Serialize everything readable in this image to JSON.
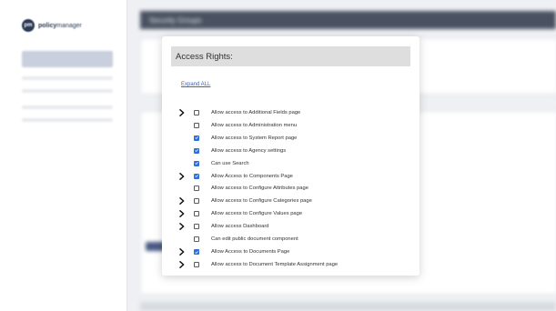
{
  "sidebar": {
    "logo_badge": "pm",
    "logo_text_bold": "policy",
    "logo_text_rest": "manager"
  },
  "main": {
    "header_title": "Security Groups"
  },
  "modal": {
    "title": "Access Rights:",
    "expand_all": "Expand ALL",
    "rights": [
      {
        "label": "Allow access to Additional Fields page",
        "checked": false,
        "expandable": true
      },
      {
        "label": "Allow access to Administration menu",
        "checked": false,
        "expandable": false
      },
      {
        "label": "Allow access to System Report page",
        "checked": true,
        "expandable": false
      },
      {
        "label": "Allow access to Agency settings",
        "checked": true,
        "expandable": false
      },
      {
        "label": "Can use Search",
        "checked": true,
        "expandable": false
      },
      {
        "label": "Allow Access to Components Page",
        "checked": true,
        "expandable": true
      },
      {
        "label": "Allow access to Configure Attributes page",
        "checked": false,
        "expandable": false
      },
      {
        "label": "Allow access to Configure Categories page",
        "checked": false,
        "expandable": true
      },
      {
        "label": "Allow access to Configure Values page",
        "checked": false,
        "expandable": true
      },
      {
        "label": "Allow access Dashboard",
        "checked": false,
        "expandable": true
      },
      {
        "label": "Can edit public document component",
        "checked": false,
        "expandable": false
      },
      {
        "label": "Allow Access to Documents Page",
        "checked": true,
        "expandable": true
      },
      {
        "label": "Allow access to Document Template Assignment page",
        "checked": false,
        "expandable": true
      }
    ]
  },
  "colors": {
    "accent": "#2f6fd6",
    "link": "#3b63c4",
    "header_bar": "#4a5262"
  }
}
